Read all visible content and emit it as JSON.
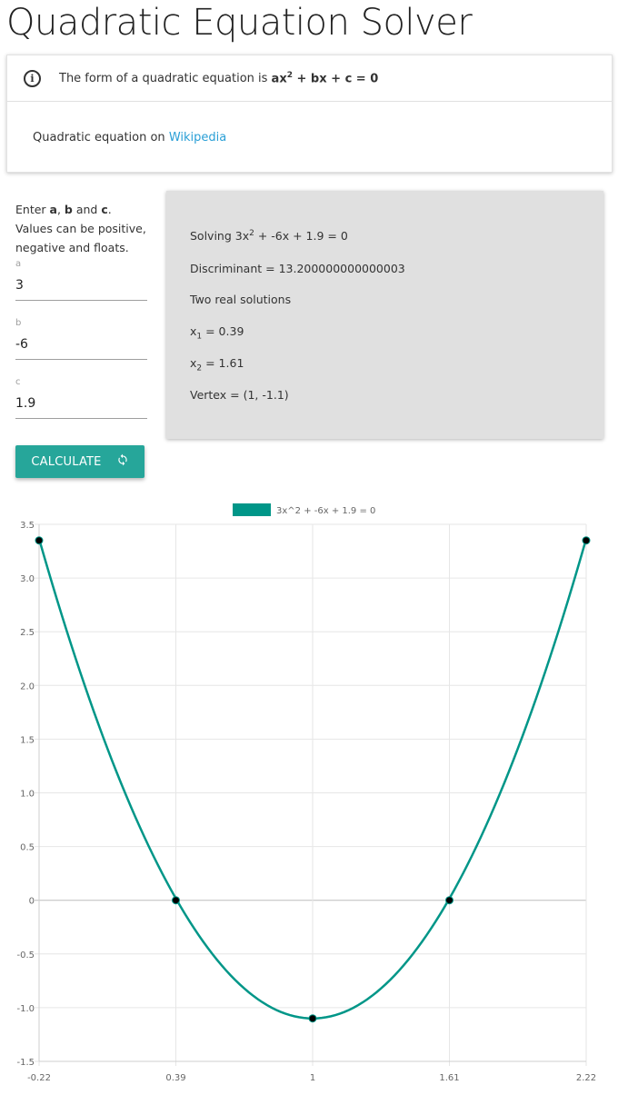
{
  "page": {
    "title": "Quadratic Equation Solver"
  },
  "info": {
    "form_prefix": "The form of a quadratic equation is ",
    "form_equation_head": "ax",
    "form_equation_exp": "2",
    "form_equation_tail": " + bx + c = 0",
    "wiki_prefix": "Quadratic equation on ",
    "wiki_link": "Wikipedia"
  },
  "inputs": {
    "instr_1": "Enter ",
    "instr_a": "a",
    "instr_2": ", ",
    "instr_b": "b",
    "instr_3": " and ",
    "instr_c": "c",
    "instr_4": ". Values can be positive, negative and floats.",
    "a_label": "a",
    "a_value": "3",
    "b_label": "b",
    "b_value": "-6",
    "c_label": "c",
    "c_value": "1.9"
  },
  "result": {
    "solving_prefix": "Solving 3x",
    "solving_exp": "2",
    "solving_suffix": " + -6x + 1.9 = 0",
    "discriminant": "Discriminant = 13.200000000000003",
    "solutions_type": "Two real solutions",
    "x1_base": "x",
    "x1_sub": "1",
    "x1_value": " = 0.39",
    "x2_base": "x",
    "x2_sub": "2",
    "x2_value": " = 1.61",
    "vertex": "Vertex = (1, -1.1)"
  },
  "button": {
    "label": "CALCULATE",
    "icon": "refresh-icon"
  },
  "colors": {
    "accent": "#26a69a",
    "series": "#009688",
    "card_bg": "#e0e0e0"
  },
  "chart_data": {
    "type": "line",
    "series": [
      {
        "name": "3x^2 + -6x + 1.9 = 0",
        "x": [
          -0.22,
          0.39,
          1,
          1.61,
          2.22
        ],
        "y": [
          3.35,
          0,
          -1.1,
          0,
          3.35
        ]
      }
    ],
    "x_ticks": [
      "-0.22",
      "0.39",
      "1",
      "1.61",
      "2.22"
    ],
    "y_ticks": [
      "3.5",
      "3.0",
      "2.5",
      "2.0",
      "1.5",
      "1.0",
      "0.5",
      "0",
      "-0.5",
      "-1.0",
      "-1.5"
    ],
    "xlim": [
      -0.22,
      2.22
    ],
    "ylim": [
      -1.5,
      3.5
    ],
    "legend": "top",
    "grid": true,
    "curve": {
      "a": 3,
      "b": -6,
      "c": 1.9
    }
  }
}
